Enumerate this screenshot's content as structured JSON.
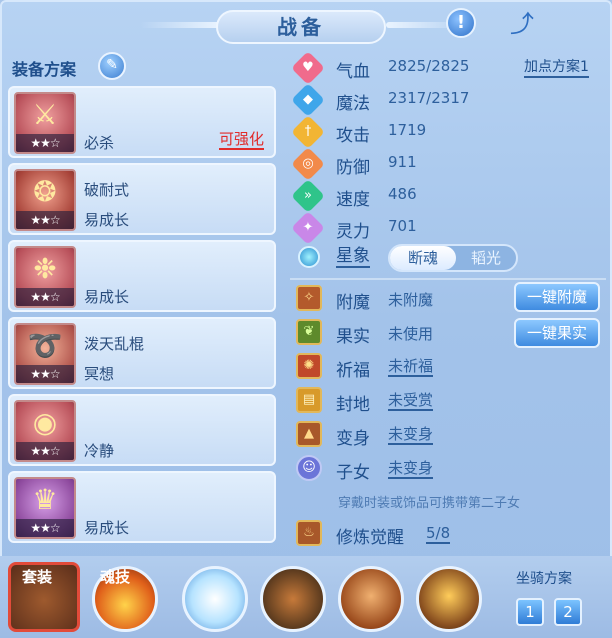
{
  "header": {
    "title": "战备"
  },
  "left": {
    "scheme_label": "装备方案",
    "equipment": [
      {
        "name": "",
        "trait": "必杀",
        "tag": "可强化",
        "stars": "★★☆",
        "icon": "sword-icon"
      },
      {
        "name": "破耐式",
        "trait": "易成长",
        "tag": "",
        "stars": "★★☆",
        "icon": "armor-icon"
      },
      {
        "name": "",
        "trait": "易成长",
        "tag": "",
        "stars": "★★☆",
        "icon": "necklace-icon"
      },
      {
        "name": "泼天乱棍",
        "trait": "冥想",
        "tag": "",
        "stars": "★★☆",
        "icon": "chain-icon"
      },
      {
        "name": "",
        "trait": "冷静",
        "tag": "",
        "stars": "★★☆",
        "icon": "belt-icon"
      },
      {
        "name": "",
        "trait": "易成长",
        "tag": "",
        "stars": "★★☆",
        "icon": "boots-icon"
      }
    ]
  },
  "stats": {
    "points_scheme": "加点方案1",
    "items": [
      {
        "label": "气血",
        "value": "2825/2825",
        "color": "#f06b8c",
        "glyph": "♥"
      },
      {
        "label": "魔法",
        "value": "2317/2317",
        "color": "#3fa6ea",
        "glyph": "◆"
      },
      {
        "label": "攻击",
        "value": "1719",
        "color": "#f2b534",
        "glyph": "†"
      },
      {
        "label": "防御",
        "value": "911",
        "color": "#f28a4a",
        "glyph": "◎"
      },
      {
        "label": "速度",
        "value": "486",
        "color": "#2fc48a",
        "glyph": "»"
      },
      {
        "label": "灵力",
        "value": "701",
        "color": "#c987e8",
        "glyph": "✦"
      }
    ]
  },
  "star": {
    "label": "星象",
    "option_a": "断魂",
    "option_b": "韬光"
  },
  "misc": {
    "rows": [
      {
        "label": "附魔",
        "value": "未附魔",
        "underline": false,
        "icon": "enchant-icon",
        "glyph": "✧"
      },
      {
        "label": "果实",
        "value": "未使用",
        "underline": false,
        "icon": "fruit-icon",
        "glyph": "❦"
      },
      {
        "label": "祈福",
        "value": "未祈福",
        "underline": true,
        "icon": "blessing-icon",
        "glyph": "✺"
      },
      {
        "label": "封地",
        "value": "未受赏",
        "underline": true,
        "icon": "fief-icon",
        "glyph": "▤"
      },
      {
        "label": "变身",
        "value": "未变身",
        "underline": true,
        "icon": "transform-icon",
        "glyph": "▲"
      },
      {
        "label": "子女",
        "value": "未变身",
        "underline": true,
        "icon": "child-icon",
        "glyph": "☺"
      }
    ],
    "enchant_button": "一键附魔",
    "fruit_button": "一键果实",
    "hint": "穿戴时装或饰品可携带第二子女",
    "awaken_label": "修炼觉醒",
    "awaken_value": "5/8"
  },
  "bottom": {
    "set_label": "套装",
    "skill_label": "魂技",
    "mount_label": "坐骑方案",
    "mount_1": "1",
    "mount_2": "2"
  }
}
